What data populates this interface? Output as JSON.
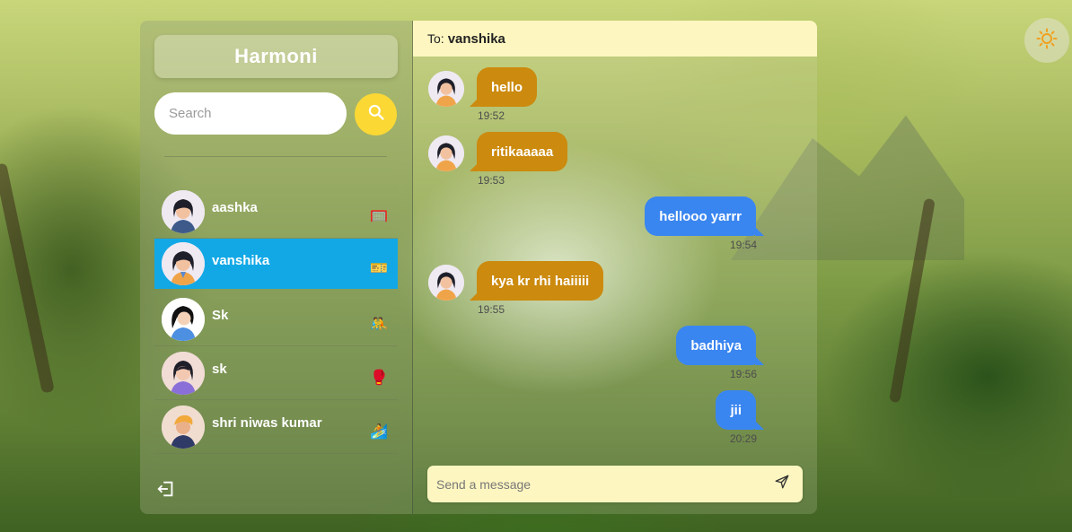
{
  "app": {
    "title": "Harmoni"
  },
  "search": {
    "placeholder": "Search"
  },
  "contacts": [
    {
      "name": "aashka",
      "emoji": "🥅",
      "active": false
    },
    {
      "name": "vanshika",
      "emoji": "🎫",
      "active": true
    },
    {
      "name": "Sk",
      "emoji": "🤼",
      "active": false
    },
    {
      "name": "sk",
      "emoji": "🥊",
      "active": false
    },
    {
      "name": "shri niwas kumar",
      "emoji": "🏄",
      "active": false
    }
  ],
  "chat": {
    "to_label": "To:",
    "recipient": "vanshika",
    "messages": [
      {
        "text": "hello",
        "time": "19:52",
        "direction": "in"
      },
      {
        "text": "ritikaaaaa",
        "time": "19:53",
        "direction": "in"
      },
      {
        "text": "hellooo yarrr",
        "time": "19:54",
        "direction": "out"
      },
      {
        "text": "kya kr rhi haiiiii",
        "time": "19:55",
        "direction": "in"
      },
      {
        "text": "badhiya",
        "time": "19:56",
        "direction": "out"
      },
      {
        "text": "jii",
        "time": "20:29",
        "direction": "out"
      }
    ],
    "composer_placeholder": "Send a message"
  },
  "icons": {
    "theme_toggle": "sun-icon",
    "search": "search-icon",
    "logout": "logout-icon",
    "send": "send-icon"
  },
  "colors": {
    "active_contact": "#12a8e6",
    "incoming_bubble": "#cc8a0e",
    "outgoing_bubble": "#3a86f0",
    "search_button": "#fcd835",
    "header_bg": "#fdf6c0"
  }
}
